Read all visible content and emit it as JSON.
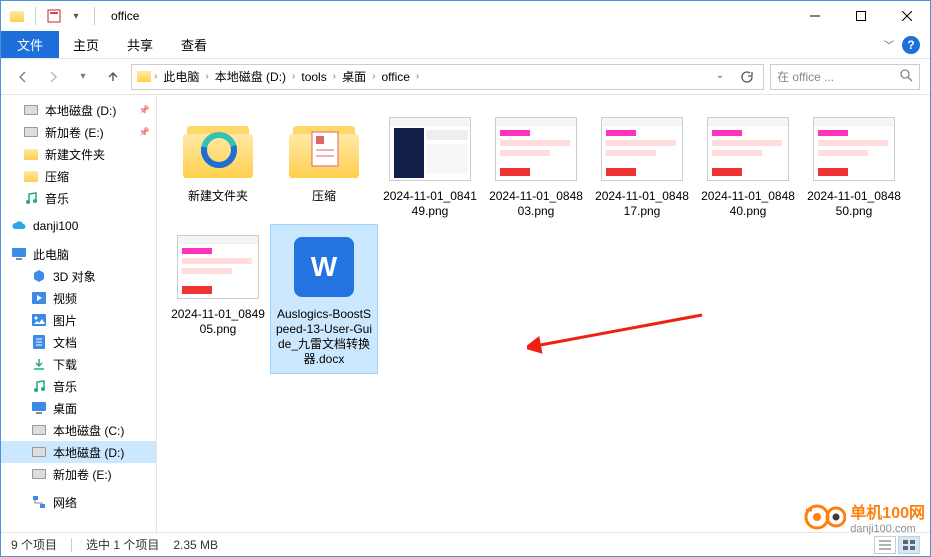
{
  "window": {
    "title": "office"
  },
  "menu": {
    "file": "文件",
    "home": "主页",
    "share": "共享",
    "view": "查看"
  },
  "breadcrumb": [
    "此电脑",
    "本地磁盘 (D:)",
    "tools",
    "桌面",
    "office"
  ],
  "search": {
    "placeholder": "在 office ..."
  },
  "nav": {
    "quick": [
      {
        "label": "本地磁盘 (D:)",
        "icon": "disk",
        "pinned": true
      },
      {
        "label": "新加卷 (E:)",
        "icon": "disk",
        "pinned": true
      },
      {
        "label": "新建文件夹",
        "icon": "folder"
      },
      {
        "label": "压缩",
        "icon": "folder"
      },
      {
        "label": "音乐",
        "icon": "music"
      }
    ],
    "onedrive": "danji100",
    "pc": "此电脑",
    "pc_children": [
      {
        "label": "3D 对象",
        "icon": "3d"
      },
      {
        "label": "视频",
        "icon": "video"
      },
      {
        "label": "图片",
        "icon": "image"
      },
      {
        "label": "文档",
        "icon": "doc"
      },
      {
        "label": "下载",
        "icon": "download"
      },
      {
        "label": "音乐",
        "icon": "music"
      },
      {
        "label": "桌面",
        "icon": "desktop"
      },
      {
        "label": "本地磁盘 (C:)",
        "icon": "disk"
      },
      {
        "label": "本地磁盘 (D:)",
        "icon": "disk",
        "selected": true
      },
      {
        "label": "新加卷 (E:)",
        "icon": "disk"
      }
    ],
    "network": "网络"
  },
  "files": [
    {
      "name": "新建文件夹",
      "type": "folder",
      "overlay": "edge"
    },
    {
      "name": "压缩",
      "type": "folder",
      "overlay": "zip"
    },
    {
      "name": "2024-11-01_084149.png",
      "type": "png",
      "variant": "dark"
    },
    {
      "name": "2024-11-01_084803.png",
      "type": "png",
      "variant": "pink"
    },
    {
      "name": "2024-11-01_084817.png",
      "type": "png",
      "variant": "pink"
    },
    {
      "name": "2024-11-01_084840.png",
      "type": "png",
      "variant": "pink"
    },
    {
      "name": "2024-11-01_084850.png",
      "type": "png",
      "variant": "pink"
    },
    {
      "name": "2024-11-01_084905.png",
      "type": "png",
      "variant": "pink"
    },
    {
      "name": "Auslogics-BoostSpeed-13-User-Guide_九雷文档转换器.docx",
      "type": "docx",
      "selected": true
    }
  ],
  "status": {
    "count": "9 个项目",
    "selected": "选中 1 个项目",
    "size": "2.35 MB"
  },
  "watermark": {
    "text": "单机100网",
    "url": "danji100.com"
  }
}
